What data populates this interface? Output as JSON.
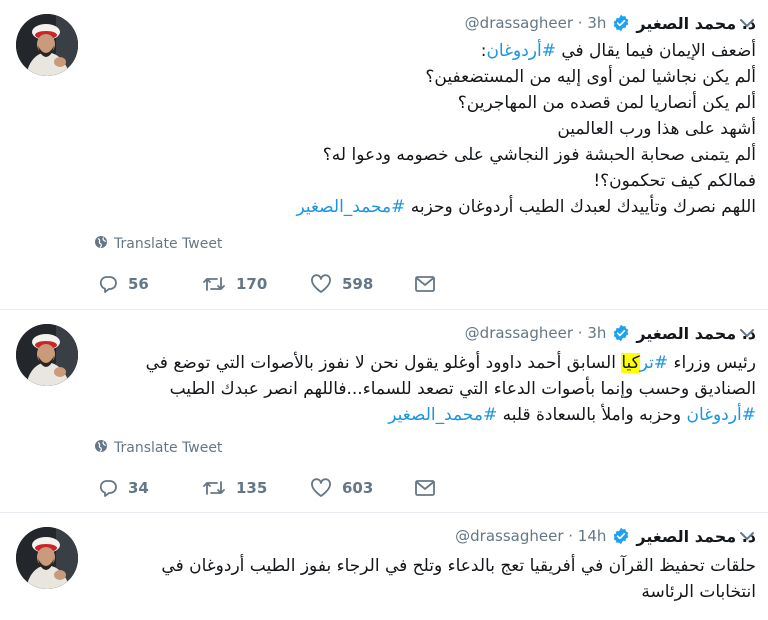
{
  "tweets": [
    {
      "name": "د. محمد الصغير",
      "handle": "@drassagheer · 3h",
      "lines": [
        {
          "pre": "أضعف الإيمان فيما يقال في ",
          "tag": "#أردوغان",
          "post": ":"
        },
        {
          "pre": "ألم يكن نجاشيا لمن أوى إليه من المستضعفين؟",
          "tag": "",
          "post": ""
        },
        {
          "pre": "ألم يكن أنصاريا لمن قصده من المهاجرين؟",
          "tag": "",
          "post": ""
        },
        {
          "pre": "أشهد على هذا ورب العالمين",
          "tag": "",
          "post": ""
        },
        {
          "pre": "ألم يتمنى صحابة الحبشة فوز النجاشي على خصومه ودعوا له؟",
          "tag": "",
          "post": ""
        },
        {
          "pre": "فمالكم كيف تحكمون؟!",
          "tag": "",
          "post": ""
        },
        {
          "pre": "اللهم نصرك وتأييدك لعبدك الطيب أردوغان وحزبه ",
          "tag": "#محمد_الصغير",
          "post": ""
        }
      ],
      "translate": "Translate Tweet",
      "replies": "56",
      "retweets": "170",
      "likes": "598"
    },
    {
      "name": "د. محمد الصغير",
      "handle": "@drassagheer · 3h",
      "line1_pre": "رئيس وزراء ",
      "line1_tag_hash": "#تر",
      "line1_tag_mark": "كيا",
      "line1_post": " السابق أحمد داوود أوغلو يقول نحن لا نفوز بالأصوات التي توضع في",
      "line2": "الصناديق وحسب وإنما بأصوات الدعاء التي تصعد للسماء...فاللهم انصر عبدك الطيب",
      "line3_tag": "#أردوغان",
      "line3_mid": " وحزبه واملأ بالسعادة قلبه ",
      "line3_tag2": "#محمد_الصغير",
      "translate": "Translate Tweet",
      "replies": "34",
      "retweets": "135",
      "likes": "603"
    },
    {
      "name": "د. محمد الصغير",
      "handle": "@drassagheer · 14h",
      "lines": [
        "حلقات تحفيظ القرآن في أفريقيا تعج بالدعاء وتلح في الرجاء بفوز الطيب أردوغان في",
        "انتخابات الرئاسة"
      ]
    }
  ],
  "colors": {
    "link": "#1b95e0",
    "meta": "#657786",
    "highlight": "#ffff00"
  },
  "icons": [
    "caret-down-icon",
    "verified-badge-icon",
    "globe-icon",
    "reply-icon",
    "retweet-icon",
    "like-icon",
    "message-icon"
  ]
}
